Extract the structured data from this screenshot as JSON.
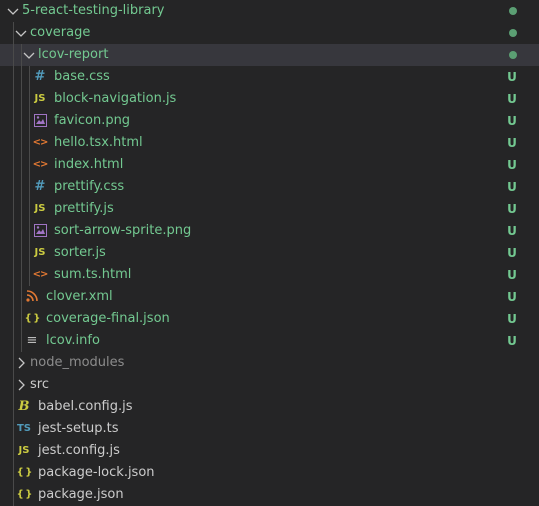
{
  "colors": {
    "untracked_green": "#73c991",
    "ignored_gray": "#8c8c8c",
    "default_text": "#cccccc",
    "dot_green": "#5b9f73",
    "css_blue": "#519aba",
    "js_yellow": "#cbcb41",
    "image_purple": "#a074c4",
    "html_orange": "#e37933",
    "xml_orange": "#e37933",
    "json_yellow": "#cbcb41",
    "info_gray": "#bbbbbb",
    "ts_blue": "#519aba",
    "babel_yellow": "#cbcb41"
  },
  "tree": [
    {
      "name": "5-react-testing-library",
      "kind": "folder",
      "expanded": true,
      "depth": 0,
      "color": "untracked_green",
      "status": "dot"
    },
    {
      "name": "coverage",
      "kind": "folder",
      "expanded": true,
      "depth": 1,
      "color": "untracked_green",
      "status": "dot"
    },
    {
      "name": "lcov-report",
      "kind": "folder",
      "expanded": true,
      "depth": 2,
      "color": "untracked_green",
      "status": "dot",
      "selected": true
    },
    {
      "name": "base.css",
      "kind": "file",
      "icon": "css-icon",
      "depth": 3,
      "color": "untracked_green",
      "status": "U"
    },
    {
      "name": "block-navigation.js",
      "kind": "file",
      "icon": "js-icon",
      "depth": 3,
      "color": "untracked_green",
      "status": "U"
    },
    {
      "name": "favicon.png",
      "kind": "file",
      "icon": "image-icon",
      "depth": 3,
      "color": "untracked_green",
      "status": "U"
    },
    {
      "name": "hello.tsx.html",
      "kind": "file",
      "icon": "html-icon",
      "depth": 3,
      "color": "untracked_green",
      "status": "U"
    },
    {
      "name": "index.html",
      "kind": "file",
      "icon": "html-icon",
      "depth": 3,
      "color": "untracked_green",
      "status": "U"
    },
    {
      "name": "prettify.css",
      "kind": "file",
      "icon": "css-icon",
      "depth": 3,
      "color": "untracked_green",
      "status": "U"
    },
    {
      "name": "prettify.js",
      "kind": "file",
      "icon": "js-icon",
      "depth": 3,
      "color": "untracked_green",
      "status": "U"
    },
    {
      "name": "sort-arrow-sprite.png",
      "kind": "file",
      "icon": "image-icon",
      "depth": 3,
      "color": "untracked_green",
      "status": "U"
    },
    {
      "name": "sorter.js",
      "kind": "file",
      "icon": "js-icon",
      "depth": 3,
      "color": "untracked_green",
      "status": "U"
    },
    {
      "name": "sum.ts.html",
      "kind": "file",
      "icon": "html-icon",
      "depth": 3,
      "color": "untracked_green",
      "status": "U"
    },
    {
      "name": "clover.xml",
      "kind": "file",
      "icon": "rss-icon",
      "depth": 2,
      "color": "untracked_green",
      "status": "U"
    },
    {
      "name": "coverage-final.json",
      "kind": "file",
      "icon": "json-icon",
      "depth": 2,
      "color": "untracked_green",
      "status": "U"
    },
    {
      "name": "lcov.info",
      "kind": "file",
      "icon": "info-icon",
      "depth": 2,
      "color": "untracked_green",
      "status": "U"
    },
    {
      "name": "node_modules",
      "kind": "folder",
      "expanded": false,
      "depth": 1,
      "color": "ignored_gray",
      "status": ""
    },
    {
      "name": "src",
      "kind": "folder",
      "expanded": false,
      "depth": 1,
      "color": "default_text",
      "status": ""
    },
    {
      "name": "babel.config.js",
      "kind": "file",
      "icon": "babel-icon",
      "depth": 1,
      "color": "default_text",
      "status": ""
    },
    {
      "name": "jest-setup.ts",
      "kind": "file",
      "icon": "ts-icon",
      "depth": 1,
      "color": "default_text",
      "status": ""
    },
    {
      "name": "jest.config.js",
      "kind": "file",
      "icon": "js-icon",
      "depth": 1,
      "color": "default_text",
      "status": ""
    },
    {
      "name": "package-lock.json",
      "kind": "file",
      "icon": "json-icon",
      "depth": 1,
      "color": "default_text",
      "status": ""
    },
    {
      "name": "package.json",
      "kind": "file",
      "icon": "json-icon",
      "depth": 1,
      "color": "default_text",
      "status": ""
    }
  ],
  "icon_glyphs": {
    "css-icon": "#",
    "js-icon": "JS",
    "html-icon": "<>",
    "json-icon": "{ }",
    "ts-icon": "TS",
    "babel-icon": "B",
    "info-icon": "≡",
    "rss-icon": "",
    "image-icon": ""
  },
  "icon_colors": {
    "css-icon": "css_blue",
    "js-icon": "js_yellow",
    "html-icon": "html_orange",
    "json-icon": "json_yellow",
    "ts-icon": "ts_blue",
    "babel-icon": "babel_yellow",
    "info-icon": "info_gray",
    "rss-icon": "xml_orange",
    "image-icon": "image_purple"
  }
}
